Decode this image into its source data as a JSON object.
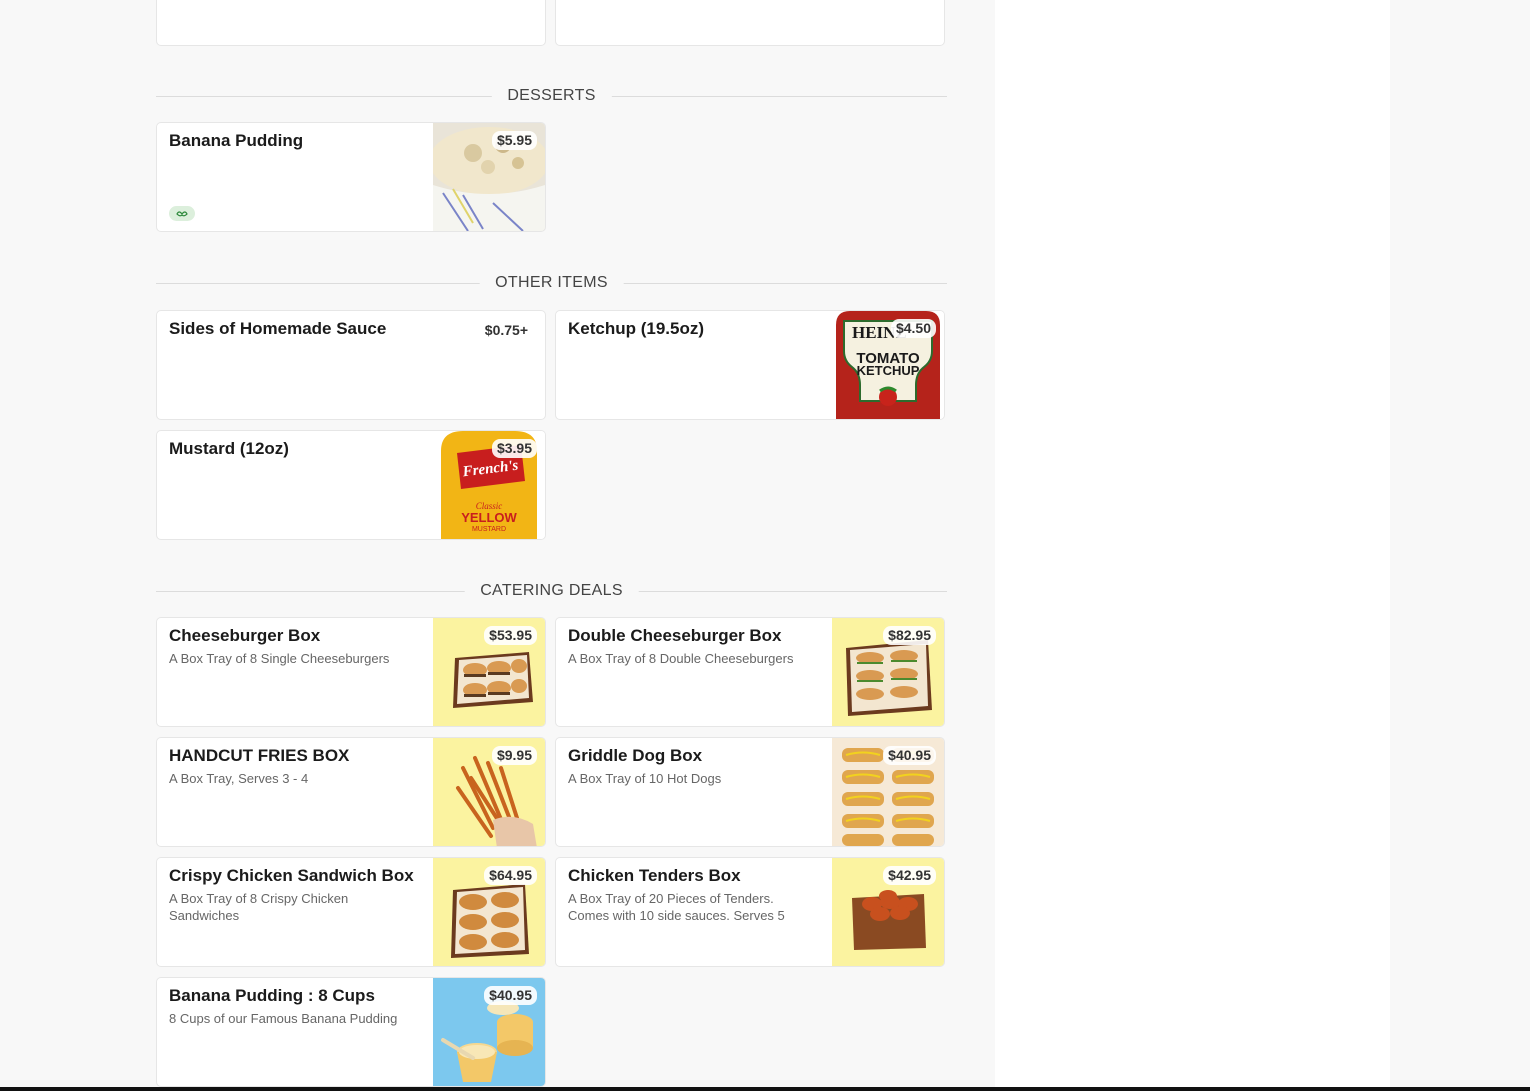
{
  "sections": {
    "desserts": "DESSERTS",
    "other": "OTHER ITEMS",
    "catering": "CATERING DEALS"
  },
  "items": {
    "banana_pudding": {
      "name": "Banana Pudding",
      "price": "$5.95",
      "badge_icon": "leaf-icon"
    },
    "sauce": {
      "name": "Sides of Homemade Sauce",
      "price": "$0.75+"
    },
    "ketchup": {
      "name": "Ketchup (19.5oz)",
      "price": "$4.50"
    },
    "mustard": {
      "name": "Mustard (12oz)",
      "price": "$3.95"
    },
    "cheeseburger_box": {
      "name": "Cheeseburger Box",
      "desc": "A Box Tray of 8 Single Cheeseburgers",
      "price": "$53.95"
    },
    "double_box": {
      "name": "Double Cheeseburger Box",
      "desc": "A Box Tray of 8 Double Cheeseburgers",
      "price": "$82.95"
    },
    "fries_box": {
      "name": "HANDCUT FRIES BOX",
      "desc": "A Box Tray, Serves 3 - 4",
      "price": "$9.95"
    },
    "dog_box": {
      "name": "Griddle Dog Box",
      "desc": "A Box Tray of 10 Hot Dogs",
      "price": "$40.95"
    },
    "chicken_box": {
      "name": "Crispy Chicken Sandwich Box",
      "desc": "A Box Tray of 8 Crispy Chicken Sandwiches",
      "price": "$64.95"
    },
    "tenders_box": {
      "name": "Chicken Tenders Box",
      "desc": "A Box Tray of 20 Pieces of Tenders. Comes with 10 side sauces. Serves 5",
      "price": "$42.95"
    },
    "pudding_cups": {
      "name": "Banana Pudding : 8 Cups",
      "desc": "8 Cups of our Famous Banana Pudding",
      "price": "$40.95"
    }
  },
  "image_text": {
    "ketchup_brand": "HEINZ",
    "ketchup_label_1": "TOMATO",
    "ketchup_label_2": "KETCHUP",
    "mustard_brand": "French's",
    "mustard_label_1": "Classic",
    "mustard_label_2": "YELLOW",
    "mustard_label_3": "MUSTARD"
  },
  "colors": {
    "page_bg": "#f8f8f8",
    "thumb_yellow": "#fbf3a0",
    "thumb_blue": "#7cc8ee",
    "veg_badge": "#dcefdc"
  }
}
